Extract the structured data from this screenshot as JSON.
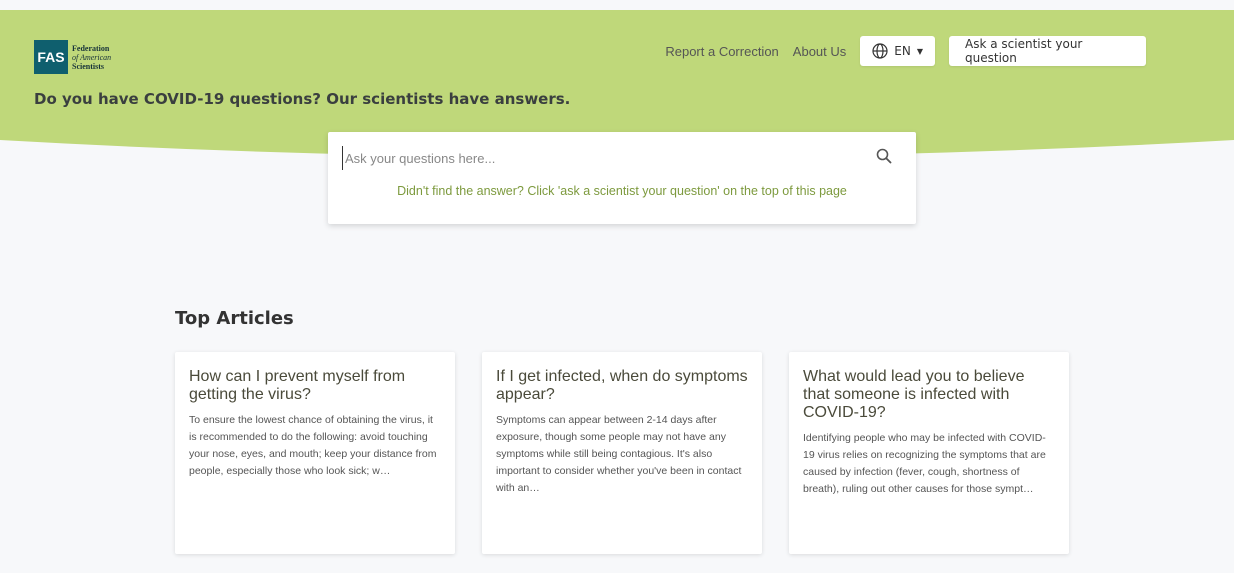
{
  "brand": {
    "logo_mark": "FAS",
    "name_line1": "Federation",
    "name_line2": "of American",
    "name_line3": "Scientists",
    "header_color": "#bfd87a",
    "logo_color": "#0f5f6e"
  },
  "nav": {
    "report_correction": "Report a Correction",
    "about_us": "About Us",
    "language": "EN",
    "ask_scientist": "Ask a scientist your question"
  },
  "hero": {
    "tagline": "Do you have COVID-19 questions? Our scientists have answers."
  },
  "search": {
    "placeholder": "Ask your questions here...",
    "hint": "Didn't find the answer? Click 'ask a scientist your question' on the top of this page"
  },
  "top_articles": {
    "title": "Top Articles",
    "items": [
      {
        "title": "How can I prevent myself from getting the virus?",
        "excerpt": "To ensure the lowest chance of obtaining the virus, it is recommended to do the following: avoid touching your nose, eyes, and mouth; keep your distance from people, especially those who look sick; w…"
      },
      {
        "title": "If I get infected, when do symptoms appear?",
        "excerpt": "Symptoms can appear between 2-14 days after exposure, though some people may not have any symptoms while still being contagious. It's also important to consider whether you've been in contact with an…"
      },
      {
        "title": "What would lead you to believe that someone is infected with COVID-19?",
        "excerpt": "Identifying people who may be infected with COVID-19 virus relies on recognizing the symptoms that are caused by infection (fever, cough, shortness of breath), ruling out other causes for those sympt…"
      }
    ]
  }
}
